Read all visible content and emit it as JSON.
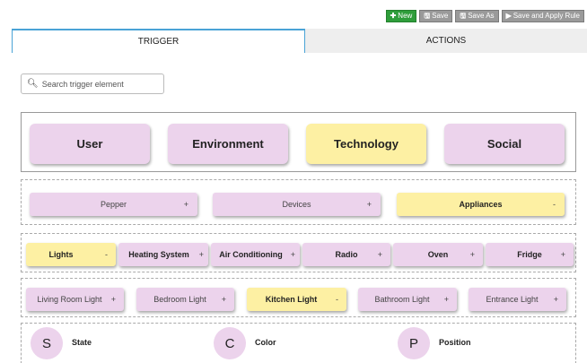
{
  "toolbar": {
    "new_label": "New",
    "save_label": "Save",
    "save_as_label": "Save As",
    "save_apply_label": "Save and Apply Rule"
  },
  "tabs": [
    {
      "label": "TRIGGER",
      "active": true
    },
    {
      "label": "ACTIONS",
      "active": false
    }
  ],
  "search": {
    "placeholder": "Search trigger element"
  },
  "categories": [
    {
      "label": "User",
      "selected": false
    },
    {
      "label": "Environment",
      "selected": false
    },
    {
      "label": "Technology",
      "selected": true
    },
    {
      "label": "Social",
      "selected": false
    }
  ],
  "tech_row": [
    {
      "label": "Pepper",
      "symbol": "+",
      "selected": false
    },
    {
      "label": "Devices",
      "symbol": "+",
      "selected": false
    },
    {
      "label": "Appliances",
      "symbol": "-",
      "selected": true
    }
  ],
  "appliance_row": [
    {
      "label": "Lights",
      "symbol": "-",
      "selected": true
    },
    {
      "label": "Heating System",
      "symbol": "+",
      "selected": false
    },
    {
      "label": "Air Conditioning",
      "symbol": "+",
      "selected": false
    },
    {
      "label": "Radio",
      "symbol": "+",
      "selected": false
    },
    {
      "label": "Oven",
      "symbol": "+",
      "selected": false
    },
    {
      "label": "Fridge",
      "symbol": "+",
      "selected": false
    }
  ],
  "lights_row": [
    {
      "label": "Living Room Light",
      "symbol": "+",
      "selected": false
    },
    {
      "label": "Bedroom Light",
      "symbol": "+",
      "selected": false
    },
    {
      "label": "Kitchen Light",
      "symbol": "-",
      "selected": true
    },
    {
      "label": "Bathroom Light",
      "symbol": "+",
      "selected": false
    },
    {
      "label": "Entrance Light",
      "symbol": "+",
      "selected": false
    }
  ],
  "attributes": [
    {
      "letter": "S",
      "label": "State"
    },
    {
      "letter": "C",
      "label": "Color"
    },
    {
      "letter": "P",
      "label": "Position"
    }
  ],
  "colors": {
    "chip_default": "#ecd3ec",
    "chip_selected": "#fdf0a3",
    "tab_accent": "#4aa3d6",
    "new_button": "#2e9d3a"
  }
}
